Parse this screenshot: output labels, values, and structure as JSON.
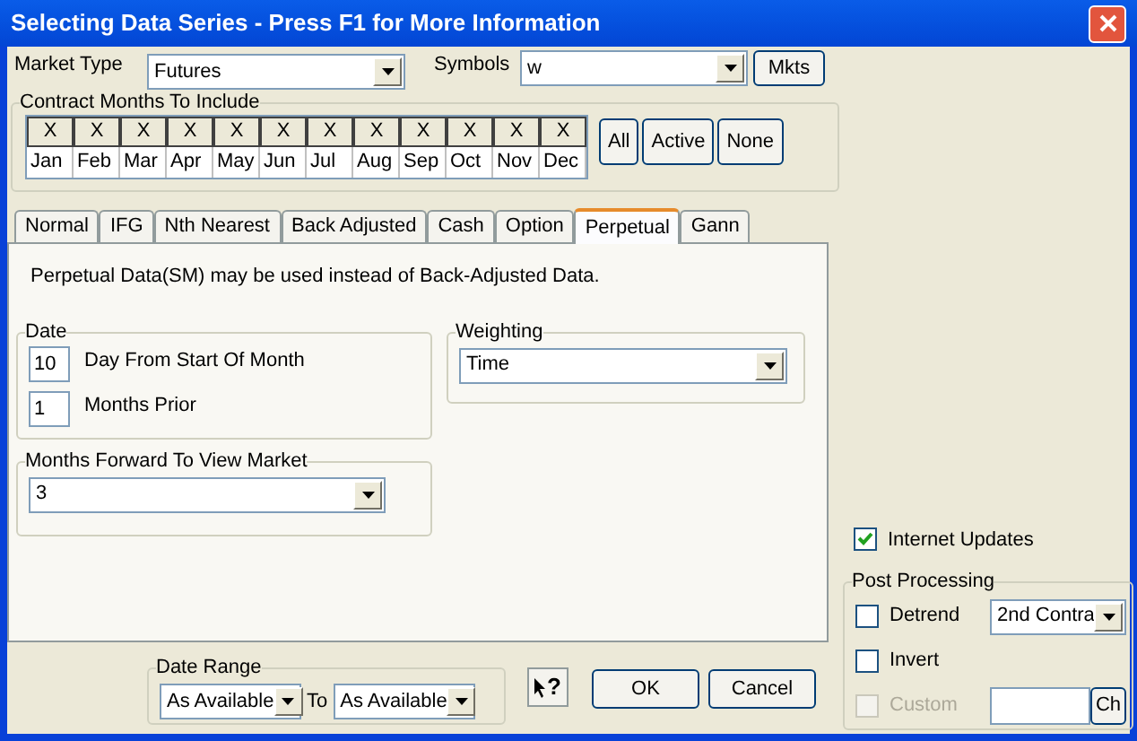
{
  "window": {
    "title": "Selecting Data Series - Press F1 for More Information"
  },
  "market_type": {
    "label": "Market Type",
    "value": "Futures"
  },
  "symbols": {
    "label": "Symbols",
    "value": "w",
    "button": "Mkts"
  },
  "contract_months": {
    "title": "Contract Months To Include",
    "months": [
      {
        "label": "Jan",
        "mark": "X",
        "checked": true
      },
      {
        "label": "Feb",
        "mark": "X",
        "checked": true
      },
      {
        "label": "Mar",
        "mark": "X",
        "checked": true
      },
      {
        "label": "Apr",
        "mark": "X",
        "checked": true
      },
      {
        "label": "May",
        "mark": "X",
        "checked": true
      },
      {
        "label": "Jun",
        "mark": "X",
        "checked": true
      },
      {
        "label": "Jul",
        "mark": "X",
        "checked": true
      },
      {
        "label": "Aug",
        "mark": "X",
        "checked": true
      },
      {
        "label": "Sep",
        "mark": "X",
        "checked": true
      },
      {
        "label": "Oct",
        "mark": "X",
        "checked": true
      },
      {
        "label": "Nov",
        "mark": "X",
        "checked": true
      },
      {
        "label": "Dec",
        "mark": "X",
        "checked": true
      }
    ],
    "buttons": [
      "All",
      "Active",
      "None"
    ]
  },
  "tabs": [
    {
      "label": "Normal",
      "selected": false
    },
    {
      "label": "IFG",
      "selected": false
    },
    {
      "label": "Nth Nearest",
      "selected": false
    },
    {
      "label": "Back Adjusted",
      "selected": false
    },
    {
      "label": "Cash",
      "selected": false
    },
    {
      "label": "Option",
      "selected": false
    },
    {
      "label": "Perpetual",
      "selected": true
    },
    {
      "label": "Gann",
      "selected": false
    }
  ],
  "panel": {
    "note": "Perpetual Data(SM) may be used instead of Back-Adjusted Data.",
    "date": {
      "title": "Date",
      "fields": [
        {
          "value": "10",
          "label": "Day From Start Of Month"
        },
        {
          "value": "1",
          "label": "Months Prior"
        }
      ]
    },
    "weighting": {
      "title": "Weighting",
      "value": "Time"
    },
    "months_forward": {
      "title": "Months Forward To View Market",
      "value": "3"
    }
  },
  "date_range": {
    "title": "Date Range",
    "from": "As Available",
    "to_label": "To",
    "to": "As Available"
  },
  "help_button": {
    "glyph": "?"
  },
  "buttons": [
    "OK",
    "Cancel"
  ],
  "internet_updates": {
    "label": "Internet Updates",
    "checked": true
  },
  "post_processing": {
    "title": "Post Processing",
    "items": [
      {
        "kind": "select",
        "label": "Detrend",
        "checked": false,
        "disabled": false,
        "value": "2nd Contra"
      },
      {
        "kind": "plain",
        "label": "Invert",
        "checked": false,
        "disabled": false
      },
      {
        "kind": "field",
        "label": "Custom",
        "checked": false,
        "disabled": true,
        "button": "Ch"
      }
    ]
  }
}
